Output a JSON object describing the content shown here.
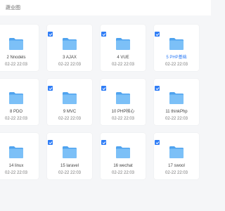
{
  "header": {
    "title": "蔬业图"
  },
  "colors": {
    "accent": "#2f7df6",
    "folder": "#6cb6f5"
  },
  "folders": [
    {
      "name": "2 Nnodels",
      "date": "02-22 22:03",
      "checked": true,
      "active": false
    },
    {
      "name": "3 AJAX",
      "date": "02-22 22:03",
      "checked": true,
      "active": false
    },
    {
      "name": "4 VUE",
      "date": "02-22 22:03",
      "checked": true,
      "active": false
    },
    {
      "name": "5 PHP基础",
      "date": "02-22 22:03",
      "checked": true,
      "active": true
    },
    {
      "name": "8 PDO",
      "date": "02-22 22:03",
      "checked": true,
      "active": false
    },
    {
      "name": "9 MVC",
      "date": "02-22 22:03",
      "checked": true,
      "active": false
    },
    {
      "name": "10 PHP核心",
      "date": "02-22 22:03",
      "checked": true,
      "active": false
    },
    {
      "name": "11 thinkPhp",
      "date": "02-22 22:03",
      "checked": true,
      "active": false
    },
    {
      "name": "14 linux",
      "date": "02-22 22:03",
      "checked": true,
      "active": false
    },
    {
      "name": "15 laravel",
      "date": "02-22 22:03",
      "checked": true,
      "active": false
    },
    {
      "name": "16 wechat",
      "date": "02-22 22:03",
      "checked": true,
      "active": false
    },
    {
      "name": "17 swool",
      "date": "02-22 22:03",
      "checked": true,
      "active": false
    }
  ]
}
